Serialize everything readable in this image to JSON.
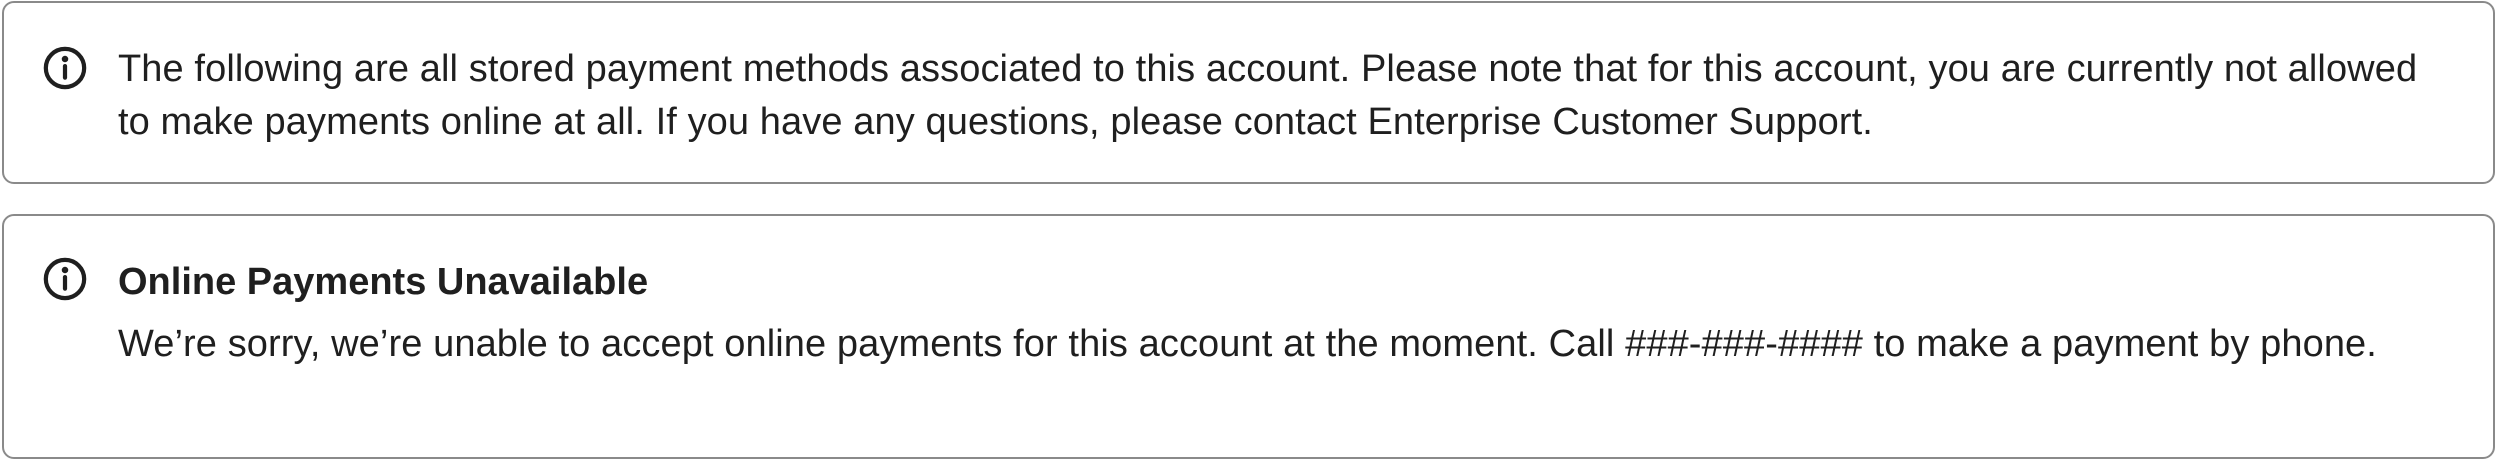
{
  "info_alert": {
    "icon": "info-icon",
    "message": "The following are all stored payment methods associated to this account. Please note that for this account, you are currently not allowed to make payments online at all. If you have any questions, please contact Enterprise Customer Support."
  },
  "unavailable_alert": {
    "icon": "info-icon",
    "title": "Online Payments Unavailable",
    "message": "We’re sorry, we’re unable to accept online payments for this account at the moment. Call ###-###-#### to make a payment by phone."
  },
  "colors": {
    "border": "#8a8a8a",
    "text": "#1f1f1f",
    "background": "#ffffff"
  }
}
